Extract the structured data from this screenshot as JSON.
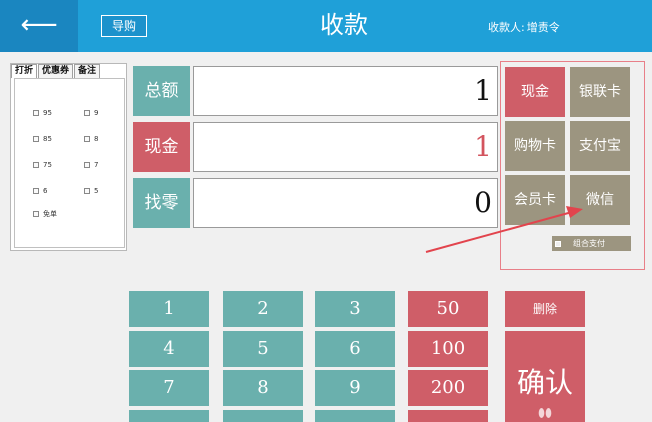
{
  "header": {
    "back_icon": "arrow-left-icon",
    "back_glyph": "⟵",
    "guide_label": "导购",
    "title": "收款",
    "cashier_label": "收款人:",
    "cashier_name": "增责令"
  },
  "left_panel": {
    "tabs": [
      "打折",
      "优惠券",
      "备注"
    ],
    "options": [
      "95",
      "9",
      "85",
      "8",
      "75",
      "7",
      "6",
      "5",
      "免单"
    ]
  },
  "amounts": {
    "total_label": "总额",
    "total_value": "1",
    "cash_label": "现金",
    "cash_value": "1",
    "change_label": "找零",
    "change_value": "0"
  },
  "payment_methods": [
    "现金",
    "银联卡",
    "购物卡",
    "支付宝",
    "会员卡",
    "微信"
  ],
  "combo_label": "组合支付",
  "keypad": {
    "keys": [
      "1",
      "2",
      "3",
      "4",
      "5",
      "6",
      "7",
      "8",
      "9"
    ],
    "quick_amounts": [
      "50",
      "100",
      "200"
    ],
    "delete_label": "删除",
    "confirm_label": "确认"
  },
  "colors": {
    "header_bg": "#1fa0d8",
    "teal": "#6ab0ad",
    "red": "#cf5e68",
    "tan": "#9c9580",
    "annotation_arrow": "#e2444d"
  }
}
